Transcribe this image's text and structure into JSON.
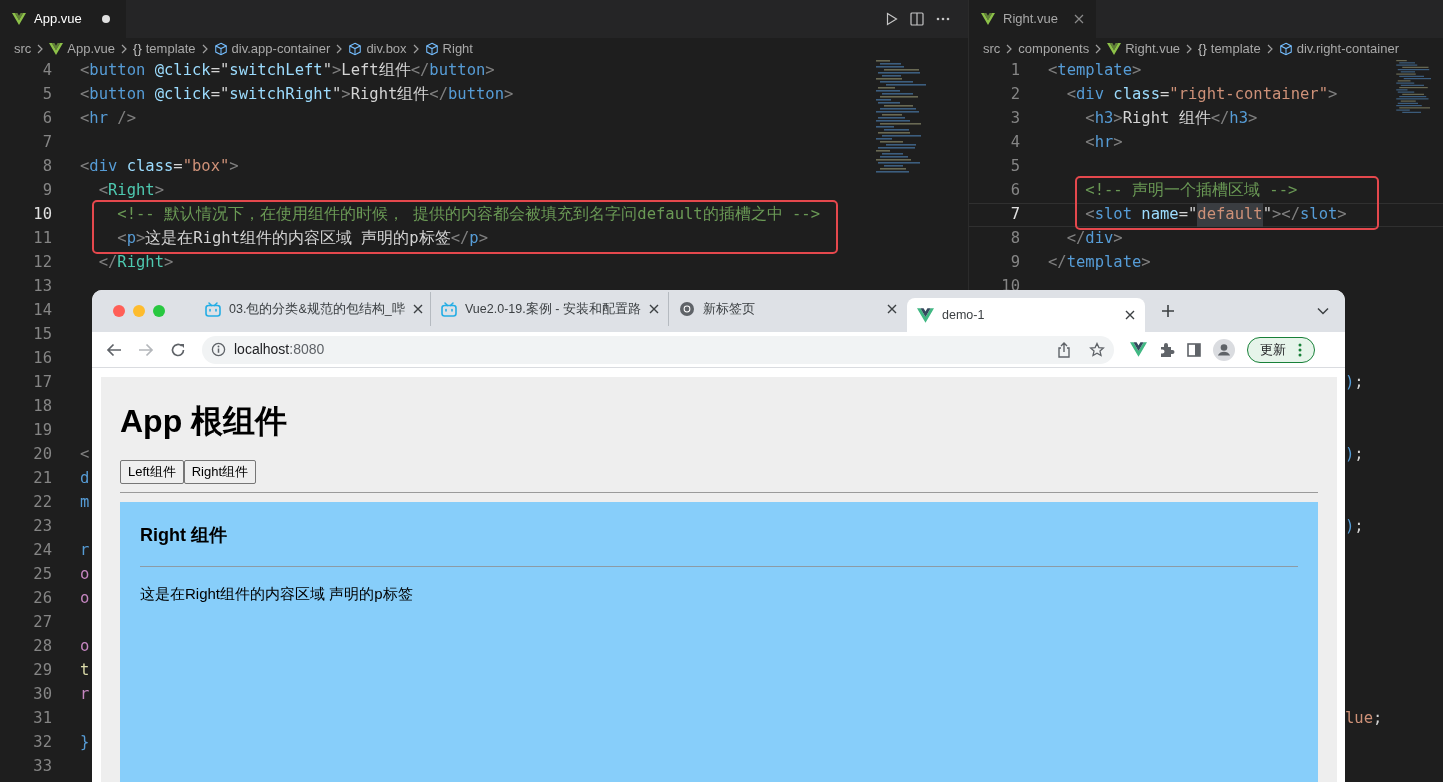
{
  "left_editor": {
    "tabs": [
      {
        "label": "App.vue",
        "selected": true,
        "modified": true
      }
    ],
    "breadcrumbs": [
      {
        "kind": "plain",
        "label": "src"
      },
      {
        "kind": "vue",
        "label": "App.vue"
      },
      {
        "kind": "braces",
        "glyph": "{}",
        "label": "template"
      },
      {
        "kind": "element",
        "label": "div.app-container"
      },
      {
        "kind": "element",
        "label": "div.box"
      },
      {
        "kind": "element",
        "label": "Right"
      }
    ],
    "lines": [
      {
        "number": "4",
        "current": false,
        "boxed": false,
        "tokens": [
          {
            "kind": "p",
            "text": "<"
          },
          {
            "kind": "tag",
            "text": "button "
          },
          {
            "kind": "attr",
            "text": "@click"
          },
          {
            "kind": "text",
            "text": "=\""
          },
          {
            "kind": "attr",
            "text": "switchLeft"
          },
          {
            "kind": "text",
            "text": "\""
          },
          {
            "kind": "p",
            "text": ">"
          },
          {
            "kind": "text",
            "text": "Left组件"
          },
          {
            "kind": "p",
            "text": "</"
          },
          {
            "kind": "tag",
            "text": "button"
          },
          {
            "kind": "p",
            "text": ">"
          }
        ]
      },
      {
        "number": "5",
        "current": false,
        "boxed": false,
        "tokens": [
          {
            "kind": "p",
            "text": "<"
          },
          {
            "kind": "tag",
            "text": "button "
          },
          {
            "kind": "attr",
            "text": "@click"
          },
          {
            "kind": "text",
            "text": "=\""
          },
          {
            "kind": "attr",
            "text": "switchRight"
          },
          {
            "kind": "text",
            "text": "\""
          },
          {
            "kind": "p",
            "text": ">"
          },
          {
            "kind": "text",
            "text": "Right组件"
          },
          {
            "kind": "p",
            "text": "</"
          },
          {
            "kind": "tag",
            "text": "button"
          },
          {
            "kind": "p",
            "text": ">"
          }
        ]
      },
      {
        "number": "6",
        "current": false,
        "boxed": false,
        "tokens": [
          {
            "kind": "p",
            "text": "<"
          },
          {
            "kind": "tag",
            "text": "hr "
          },
          {
            "kind": "p",
            "text": "/>"
          }
        ]
      },
      {
        "number": "7",
        "current": false,
        "boxed": false
      },
      {
        "number": "8",
        "current": false,
        "boxed": false,
        "tokens": [
          {
            "kind": "p",
            "text": "<"
          },
          {
            "kind": "tag",
            "text": "div "
          },
          {
            "kind": "attr",
            "text": "class"
          },
          {
            "kind": "text",
            "text": "="
          },
          {
            "kind": "str",
            "text": "\"box\""
          },
          {
            "kind": "p",
            "text": ">"
          }
        ]
      },
      {
        "number": "9",
        "current": false,
        "boxed": false,
        "tokens": [
          {
            "kind": "p",
            "text": "  <"
          },
          {
            "kind": "comp",
            "text": "Right"
          },
          {
            "kind": "p",
            "text": ">"
          }
        ]
      },
      {
        "number": "10",
        "current": true,
        "boxed": true,
        "tokens": [
          {
            "kind": "comment",
            "text": "    <!-- 默认情况下，在使用组件的时候， 提供的内容都会被填充到名字问default的插槽之中 -->"
          }
        ]
      },
      {
        "number": "11",
        "current": false,
        "boxed": true,
        "tokens": [
          {
            "kind": "p",
            "text": "    <"
          },
          {
            "kind": "tag",
            "text": "p"
          },
          {
            "kind": "p",
            "text": ">"
          },
          {
            "kind": "text",
            "text": "这是在Right组件的内容区域 声明的p标签"
          },
          {
            "kind": "p",
            "text": "</"
          },
          {
            "kind": "tag",
            "text": "p"
          },
          {
            "kind": "p",
            "text": ">"
          }
        ]
      },
      {
        "number": "12",
        "current": false,
        "boxed": false,
        "tokens": [
          {
            "kind": "p",
            "text": "  </"
          },
          {
            "kind": "comp",
            "text": "Right"
          },
          {
            "kind": "p",
            "text": ">"
          }
        ]
      },
      {
        "number": "13",
        "current": false,
        "boxed": false
      },
      {
        "number": "14",
        "current": false,
        "boxed": false
      },
      {
        "number": "15",
        "current": false,
        "boxed": false
      },
      {
        "number": "16",
        "current": false,
        "boxed": false
      },
      {
        "number": "17",
        "current": false,
        "boxed": false
      },
      {
        "number": "18",
        "current": false,
        "boxed": false
      },
      {
        "number": "19",
        "current": false,
        "boxed": false
      },
      {
        "number": "20",
        "current": false,
        "boxed": false,
        "tokens": [
          {
            "kind": "p",
            "text": "<"
          }
        ]
      },
      {
        "number": "21",
        "current": false,
        "boxed": false,
        "tokens": [
          {
            "kind": "tag",
            "text": "d"
          }
        ]
      },
      {
        "number": "22",
        "current": false,
        "boxed": false,
        "tokens": [
          {
            "kind": "tag",
            "text": "m"
          }
        ]
      },
      {
        "number": "23",
        "current": false,
        "boxed": false
      },
      {
        "number": "24",
        "current": false,
        "boxed": false,
        "tokens": [
          {
            "kind": "tag",
            "text": "r"
          }
        ]
      },
      {
        "number": "25",
        "current": false,
        "boxed": false,
        "tokens": [
          {
            "kind": "kw",
            "text": "o"
          }
        ]
      },
      {
        "number": "26",
        "current": false,
        "boxed": false,
        "tokens": [
          {
            "kind": "kw",
            "text": "o"
          }
        ]
      },
      {
        "number": "27",
        "current": false,
        "boxed": false
      },
      {
        "number": "28",
        "current": false,
        "boxed": false,
        "tokens": [
          {
            "kind": "kw",
            "text": "o"
          }
        ]
      },
      {
        "number": "29",
        "current": false,
        "boxed": false,
        "tokens": [
          {
            "kind": "fn",
            "text": "t"
          }
        ]
      },
      {
        "number": "30",
        "current": false,
        "boxed": false,
        "tokens": [
          {
            "kind": "kw",
            "text": "r"
          }
        ]
      },
      {
        "number": "31",
        "current": false,
        "boxed": false
      },
      {
        "number": "32",
        "current": false,
        "boxed": false,
        "tokens": [
          {
            "kind": "tag",
            "text": "}"
          }
        ]
      },
      {
        "number": "33",
        "current": false,
        "boxed": false
      }
    ]
  },
  "right_editor": {
    "tabs": [
      {
        "label": "Right.vue",
        "selected": true,
        "modified": false
      }
    ],
    "breadcrumbs": [
      {
        "kind": "plain",
        "label": "src"
      },
      {
        "kind": "plain",
        "label": "components"
      },
      {
        "kind": "vue",
        "label": "Right.vue"
      },
      {
        "kind": "braces",
        "glyph": "{}",
        "label": "template"
      },
      {
        "kind": "element",
        "label": "div.right-container"
      }
    ],
    "lines": [
      {
        "number": "1",
        "current": false,
        "boxed": false,
        "tokens": [
          {
            "kind": "p",
            "text": "<"
          },
          {
            "kind": "tag",
            "text": "template"
          },
          {
            "kind": "p",
            "text": ">"
          }
        ]
      },
      {
        "number": "2",
        "current": false,
        "boxed": false,
        "tokens": [
          {
            "kind": "p",
            "text": "  <"
          },
          {
            "kind": "tag",
            "text": "div "
          },
          {
            "kind": "attr",
            "text": "class"
          },
          {
            "kind": "text",
            "text": "="
          },
          {
            "kind": "str",
            "text": "\"right-container\""
          },
          {
            "kind": "p",
            "text": ">"
          }
        ]
      },
      {
        "number": "3",
        "current": false,
        "boxed": false,
        "tokens": [
          {
            "kind": "p",
            "text": "    <"
          },
          {
            "kind": "tag",
            "text": "h3"
          },
          {
            "kind": "p",
            "text": ">"
          },
          {
            "kind": "text",
            "text": "Right 组件"
          },
          {
            "kind": "p",
            "text": "</"
          },
          {
            "kind": "tag",
            "text": "h3"
          },
          {
            "kind": "p",
            "text": ">"
          }
        ]
      },
      {
        "number": "4",
        "current": false,
        "boxed": false,
        "tokens": [
          {
            "kind": "p",
            "text": "    <"
          },
          {
            "kind": "tag",
            "text": "hr"
          },
          {
            "kind": "p",
            "text": ">"
          }
        ]
      },
      {
        "number": "5",
        "current": false,
        "boxed": false
      },
      {
        "number": "6",
        "current": false,
        "boxed": true,
        "tokens": [
          {
            "kind": "comment",
            "text": "    <!-- 声明一个插槽区域 -->"
          }
        ]
      },
      {
        "number": "7",
        "current": true,
        "boxed": true,
        "tokens": [
          {
            "kind": "p",
            "text": "    <"
          },
          {
            "kind": "tag",
            "text": "slot "
          },
          {
            "kind": "attr",
            "text": "name"
          },
          {
            "kind": "text",
            "text": "=\""
          },
          {
            "kind": "sel",
            "text": "default"
          },
          {
            "kind": "text",
            "text": "\""
          },
          {
            "kind": "p",
            "text": "></"
          },
          {
            "kind": "tag",
            "text": "slot"
          },
          {
            "kind": "p",
            "text": ">"
          }
        ]
      },
      {
        "number": "8",
        "current": false,
        "boxed": false,
        "tokens": [
          {
            "kind": "p",
            "text": "  </"
          },
          {
            "kind": "tag",
            "text": "div"
          },
          {
            "kind": "p",
            "text": ">"
          }
        ]
      },
      {
        "number": "9",
        "current": false,
        "boxed": false,
        "tokens": [
          {
            "kind": "p",
            "text": "</"
          },
          {
            "kind": "tag",
            "text": "template"
          },
          {
            "kind": "p",
            "text": ">"
          }
        ]
      },
      {
        "number": "10",
        "current": false,
        "boxed": false
      }
    ],
    "tail": [
      {
        "tokens": [
          {
            "kind": "tag",
            "text": ")"
          },
          {
            "kind": "text",
            "text": ";"
          }
        ]
      },
      {
        "tokens": [
          {
            "kind": "tag",
            "text": ")"
          },
          {
            "kind": "text",
            "text": ";"
          }
        ]
      },
      {
        "tokens": [
          {
            "kind": "tag",
            "text": ")"
          },
          {
            "kind": "text",
            "text": ";"
          }
        ]
      },
      {
        "tokens": [
          {
            "kind": "str",
            "text": "lue"
          },
          {
            "kind": "text",
            "text": ";"
          }
        ]
      }
    ]
  },
  "browser": {
    "tabs": [
      {
        "title": "03.包的分类&规范的包结构_哔",
        "selected": false
      },
      {
        "title": "Vue2.0-19.案例 - 安装和配置路",
        "selected": false
      },
      {
        "title": "新标签页",
        "selected": false
      },
      {
        "title": "demo-1",
        "selected": true
      }
    ],
    "address": {
      "host": "localhost",
      "port": ":8080"
    },
    "update_button": "更新",
    "page": {
      "heading": "App 根组件",
      "buttons": [
        "Left组件",
        "Right组件"
      ],
      "right_box": {
        "heading": "Right 组件",
        "paragraph": "这是在Right组件的内容区域 声明的p标签"
      }
    }
  }
}
